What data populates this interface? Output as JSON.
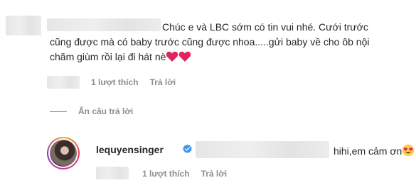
{
  "comment": {
    "text": "Chúc e và LBC sớm có tin vui nhé. Cưới trước cũng được mà có baby trước cũng được nhoa.....gửi baby về cho ôb nội chăm giùm rồi lại đi hát nè",
    "emojis": [
      "heart-icon",
      "heart-icon"
    ],
    "likes_label": "1 lượt thích",
    "reply_label": "Trả lời"
  },
  "hide_replies_label": "Ẩn câu trả lời",
  "reply": {
    "username": "lequyensinger",
    "verified": true,
    "text": "hihi,em cảm ơn",
    "emoji": "heart-eyes-icon",
    "likes_label": "1 lượt thích",
    "reply_label": "Trả lời"
  },
  "colors": {
    "text": "#262626",
    "meta": "#8e8e8e",
    "verified": "#3897f0",
    "heart": "#e0245e",
    "redaction": "#e6e6e6"
  }
}
